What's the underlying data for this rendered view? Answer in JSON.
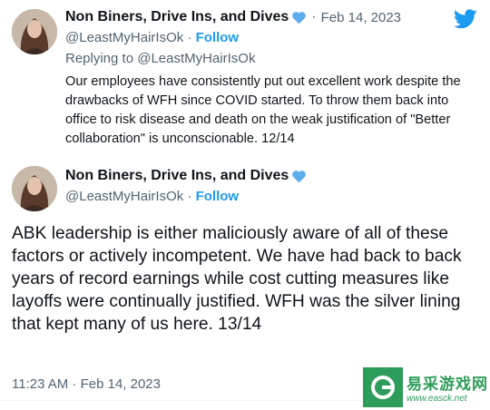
{
  "icons": {
    "logo": "twitter-bird-icon",
    "heart": "blue-heart-icon"
  },
  "colors": {
    "link": "#1d9bf0",
    "muted": "#536471",
    "text": "#0f1419",
    "watermark": "#2e9c5a"
  },
  "tweet1": {
    "display_name": "Non Biners, Drive Ins, and Dives",
    "separator": "·",
    "date": "Feb 14, 2023",
    "handle": "@LeastMyHairIsOk",
    "follow_separator": "·",
    "follow_label": "Follow",
    "replying_to": "Replying to @LeastMyHairIsOk",
    "text": "Our employees have consistently put out excellent work despite the drawbacks of WFH since COVID started. To throw them back into office to risk disease and death on the weak justification of \"Better collaboration\" is unconscionable. 12/14"
  },
  "tweet2": {
    "display_name": "Non Biners, Drive Ins, and Dives",
    "handle": "@LeastMyHairIsOk",
    "follow_separator": "·",
    "follow_label": "Follow",
    "text": "ABK leadership is either maliciously aware of all of these factors or actively incompetent. We have had back to back years of record earnings while cost cutting measures like layoffs were continually justified. WFH was the silver lining that kept many of us here. 13/14",
    "timestamp": "11:23 AM · Feb 14, 2023"
  },
  "watermark": {
    "title": "易采游戏网",
    "url": "www.easck.net"
  }
}
